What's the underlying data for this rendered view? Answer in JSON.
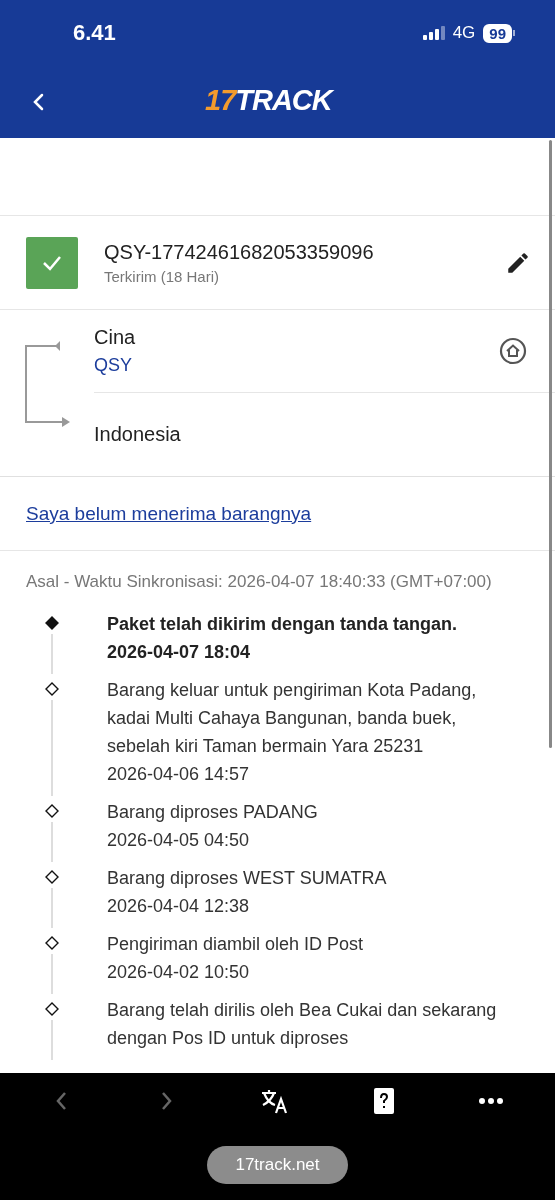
{
  "status_bar": {
    "time": "6.41",
    "network": "4G",
    "battery": "99"
  },
  "header": {
    "logo_accent": "17",
    "logo_rest": "TRACK"
  },
  "shipment": {
    "tracking_number": "QSY-17742461682053359096",
    "status": "Terkirim (18 Hari)",
    "delivered": true
  },
  "route": {
    "origin": "Cina",
    "carrier": "QSY",
    "destination": "Indonesia"
  },
  "not_received_link": "Saya belum menerima barangnya",
  "sync_info": "Asal - Waktu Sinkronisasi: 2026-04-07 18:40:33 (GMT+07:00)",
  "events": [
    {
      "description": "Paket telah dikirim dengan tanda tangan.",
      "time": "2026-04-07 18:04",
      "current": true
    },
    {
      "description": "Barang keluar untuk pengiriman Kota Padang, kadai Multi Cahaya Bangunan, banda buek, sebelah kiri Taman bermain Yara 25231",
      "time": "2026-04-06 14:57",
      "current": false
    },
    {
      "description": "Barang diproses PADANG",
      "time": "2026-04-05 04:50",
      "current": false
    },
    {
      "description": "Barang diproses WEST SUMATRA",
      "time": "2026-04-04 12:38",
      "current": false
    },
    {
      "description": "Pengiriman diambil oleh ID Post",
      "time": "2026-04-02 10:50",
      "current": false
    },
    {
      "description": "Barang telah dirilis oleh Bea Cukai dan sekarang dengan Pos ID untuk diproses",
      "current": false
    }
  ],
  "browser": {
    "url": "17track.net"
  }
}
